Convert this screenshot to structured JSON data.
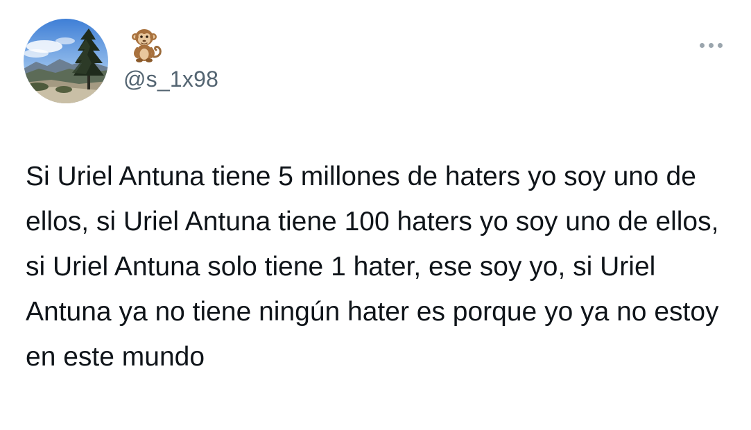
{
  "tweet": {
    "author": {
      "display_name_emoji": "🐒",
      "display_name_icon": "monkey-emoji-icon",
      "handle": "@s_1x98",
      "avatar_icon": "landscape-avatar"
    },
    "more_icon": "more-options-icon",
    "text": "Si Uriel Antuna tiene 5 millones de haters yo soy uno de ellos, si Uriel Antuna tiene 100 haters yo soy uno de ellos, si Uriel Antuna solo tiene 1 hater, ese soy yo, si Uriel Antuna ya no tiene ningún hater es porque yo ya no estoy en este mundo"
  },
  "colors": {
    "text": "#0f1419",
    "handle": "#536471",
    "more_dots": "#9aa5ad",
    "background": "#ffffff"
  }
}
